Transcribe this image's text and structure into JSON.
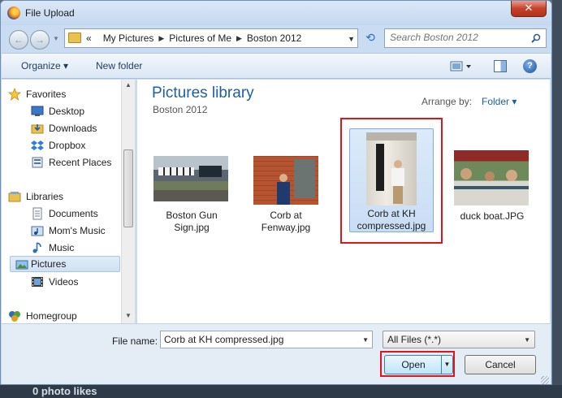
{
  "window": {
    "title": "File Upload",
    "close_label": "✕"
  },
  "address": {
    "back_label": "←",
    "forward_label": "→",
    "overflow_label": "«",
    "crumbs": [
      "My Pictures",
      "Pictures of Me",
      "Boston 2012"
    ],
    "refresh_label": "⟲"
  },
  "search": {
    "placeholder": "Search Boston 2012"
  },
  "toolbar": {
    "organize_label": "Organize ▾",
    "new_folder_label": "New folder",
    "help_label": "?"
  },
  "nav": {
    "items": [
      {
        "label": "Favorites",
        "icon": "star-icon"
      },
      {
        "label": "Desktop",
        "icon": "desktop-icon"
      },
      {
        "label": "Downloads",
        "icon": "downloads-folder-icon"
      },
      {
        "label": "Dropbox",
        "icon": "dropbox-icon"
      },
      {
        "label": "Recent Places",
        "icon": "recent-places-icon"
      },
      {
        "label": "Libraries",
        "icon": "libraries-icon"
      },
      {
        "label": "Documents",
        "icon": "documents-icon"
      },
      {
        "label": "Mom's Music",
        "icon": "music-library-icon"
      },
      {
        "label": "Music",
        "icon": "music-note-icon"
      },
      {
        "label": "Pictures",
        "icon": "pictures-icon"
      },
      {
        "label": "Videos",
        "icon": "videos-icon"
      },
      {
        "label": "Homegroup",
        "icon": "homegroup-icon"
      }
    ]
  },
  "content": {
    "title": "Pictures library",
    "subtitle": "Boston 2012",
    "arrange_label": "Arrange by:",
    "arrange_value": "Folder ▾",
    "files": [
      {
        "name": "Boston Gun Sign.jpg",
        "line1": "Boston Gun",
        "line2": "Sign.jpg"
      },
      {
        "name": "Corb at Fenway.jpg",
        "line1": "Corb at",
        "line2": "Fenway.jpg"
      },
      {
        "name": "Corb at KH compressed.jpg",
        "line1": "Corb at KH",
        "line2": "compressed.jpg"
      },
      {
        "name": "duck boat.JPG",
        "line1": "duck boat.JPG",
        "line2": ""
      }
    ]
  },
  "footer": {
    "filename_label": "File name:",
    "filename_value": "Corb at KH compressed.jpg",
    "filter_value": "All Files (*.*)",
    "open_label": "Open",
    "cancel_label": "Cancel"
  },
  "background": {
    "text": "0 photo likes"
  },
  "colors": {
    "accent": "#1e5fa0",
    "highlight_box": "#e0141b",
    "selection": "#cfe0f4"
  }
}
